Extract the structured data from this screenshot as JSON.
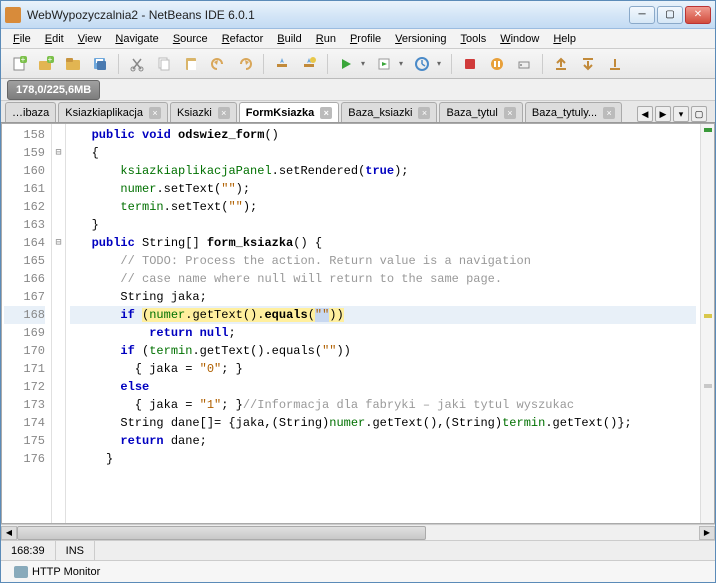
{
  "window": {
    "title": "WebWypozyczalnia2 - NetBeans IDE 6.0.1"
  },
  "menu": [
    "File",
    "Edit",
    "View",
    "Navigate",
    "Source",
    "Refactor",
    "Build",
    "Run",
    "Profile",
    "Versioning",
    "Tools",
    "Window",
    "Help"
  ],
  "memory": "178,0/225,6MB",
  "tabs": {
    "items": [
      {
        "label": "…ibaza"
      },
      {
        "label": "Ksiazkiaplikacja"
      },
      {
        "label": "Ksiazki"
      },
      {
        "label": "FormKsiazka"
      },
      {
        "label": "Baza_ksiazki"
      },
      {
        "label": "Baza_tytul"
      },
      {
        "label": "Baza_tytuly..."
      }
    ],
    "activeIndex": 3
  },
  "gutter": {
    "start": 158,
    "end": 176,
    "current": 168
  },
  "code": {
    "folds": {
      "159": "⊟",
      "164": "⊟"
    },
    "lines": [
      {
        "n": 158,
        "tokens": [
          [
            "   ",
            ""
          ],
          [
            "public ",
            "kw"
          ],
          [
            "void ",
            "kw"
          ],
          [
            "odswiez_form",
            "method"
          ],
          [
            "()",
            ""
          ]
        ]
      },
      {
        "n": 159,
        "tokens": [
          [
            "   {",
            ""
          ]
        ]
      },
      {
        "n": 160,
        "tokens": [
          [
            "       ",
            ""
          ],
          [
            "ksiazkiaplikacjaPanel",
            "id"
          ],
          [
            ".setRendered(",
            ""
          ],
          [
            "true",
            "kw"
          ],
          [
            ");",
            ""
          ]
        ]
      },
      {
        "n": 161,
        "tokens": [
          [
            "       ",
            ""
          ],
          [
            "numer",
            "id"
          ],
          [
            ".setText(",
            ""
          ],
          [
            "\"\"",
            "str"
          ],
          [
            ");",
            ""
          ]
        ]
      },
      {
        "n": 162,
        "tokens": [
          [
            "       ",
            ""
          ],
          [
            "termin",
            "id"
          ],
          [
            ".setText(",
            ""
          ],
          [
            "\"\"",
            "str"
          ],
          [
            ");",
            ""
          ]
        ]
      },
      {
        "n": 163,
        "tokens": [
          [
            "   }",
            ""
          ]
        ]
      },
      {
        "n": 164,
        "tokens": [
          [
            "   ",
            ""
          ],
          [
            "public ",
            "kw"
          ],
          [
            "String[] ",
            ""
          ],
          [
            "form_ksiazka",
            "method"
          ],
          [
            "() {",
            ""
          ]
        ]
      },
      {
        "n": 165,
        "tokens": [
          [
            "       ",
            ""
          ],
          [
            "// TODO: Process the action. Return value is a navigation",
            "cmt"
          ]
        ]
      },
      {
        "n": 166,
        "tokens": [
          [
            "       ",
            ""
          ],
          [
            "// case name where null will return to the same page.",
            "cmt"
          ]
        ]
      },
      {
        "n": 167,
        "tokens": [
          [
            "       String jaka;",
            ""
          ]
        ]
      },
      {
        "n": 168,
        "hl": true,
        "tokens": [
          [
            "       ",
            ""
          ],
          [
            "if ",
            "kw"
          ],
          [
            "(",
            "hly"
          ],
          [
            "numer",
            "id hly"
          ],
          [
            ".getText().",
            "hly"
          ],
          [
            "equals",
            "boldn hly"
          ],
          [
            "(",
            "hly"
          ],
          [
            "\"\"",
            "str hlsel"
          ],
          [
            ")",
            "hly"
          ],
          [
            ")",
            "hly"
          ]
        ]
      },
      {
        "n": 169,
        "tokens": [
          [
            "           ",
            ""
          ],
          [
            "return ",
            "kw"
          ],
          [
            "null",
            "kw"
          ],
          [
            ";",
            ""
          ]
        ]
      },
      {
        "n": 170,
        "tokens": [
          [
            "       ",
            ""
          ],
          [
            "if ",
            "kw"
          ],
          [
            "(",
            ""
          ],
          [
            "termin",
            "id"
          ],
          [
            ".getText().equals(",
            ""
          ],
          [
            "\"\"",
            "str"
          ],
          [
            "))",
            ""
          ]
        ]
      },
      {
        "n": 171,
        "tokens": [
          [
            "         { jaka = ",
            ""
          ],
          [
            "\"0\"",
            "str"
          ],
          [
            "; }",
            ""
          ]
        ]
      },
      {
        "n": 172,
        "tokens": [
          [
            "       ",
            ""
          ],
          [
            "else",
            "kw"
          ]
        ]
      },
      {
        "n": 173,
        "tokens": [
          [
            "         { jaka = ",
            ""
          ],
          [
            "\"1\"",
            "str"
          ],
          [
            "; }",
            ""
          ],
          [
            "//Informacja dla fabryki – jaki tytul wyszukac",
            "cmt"
          ]
        ]
      },
      {
        "n": 174,
        "tokens": [
          [
            "       String dane[]= {jaka,(String)",
            ""
          ],
          [
            "numer",
            "id"
          ],
          [
            ".getText(),(String)",
            ""
          ],
          [
            "termin",
            "id"
          ],
          [
            ".getText()};",
            ""
          ]
        ]
      },
      {
        "n": 175,
        "tokens": [
          [
            "       ",
            ""
          ],
          [
            "return ",
            "kw"
          ],
          [
            "dane;",
            ""
          ]
        ]
      },
      {
        "n": 176,
        "tokens": [
          [
            "     }",
            ""
          ]
        ]
      }
    ]
  },
  "status": {
    "pos": "168:39",
    "mode": "INS"
  },
  "bottom": {
    "http_monitor": "HTTP Monitor"
  },
  "icons": {
    "new_file": "#7bc04a",
    "new_project": "#7bc04a",
    "open": "#e2b552",
    "save_all": "#6fa8dc",
    "cut": "#888",
    "copy": "#c8c8c8",
    "paste": "#c8c8c8",
    "undo": "#d9a75a",
    "redo": "#d9a75a",
    "build": "#6fa8dc",
    "clean_build": "#6fa8dc",
    "run": "#3aa63a",
    "debug": "#5a8a3a",
    "profile": "#4a8ac8",
    "stop": "#d03a3a",
    "pause": "#e8a03a",
    "attach": "#888"
  }
}
